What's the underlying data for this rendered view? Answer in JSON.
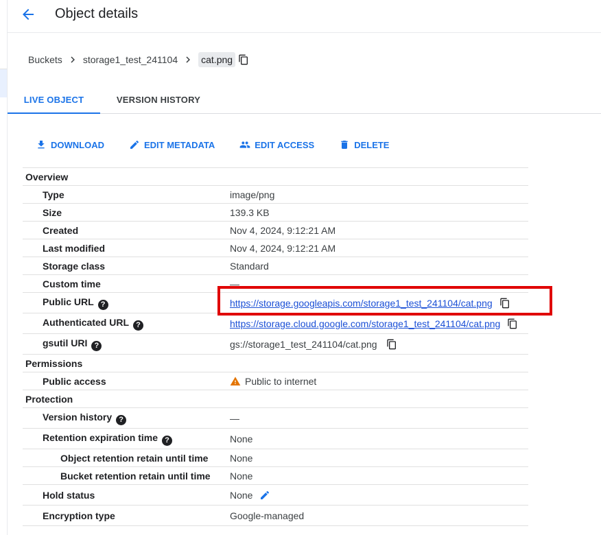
{
  "header": {
    "title": "Object details"
  },
  "breadcrumb": {
    "items": [
      "Buckets",
      "storage1_test_241104"
    ],
    "current": "cat.png"
  },
  "tabs": [
    {
      "label": "LIVE OBJECT",
      "active": true
    },
    {
      "label": "VERSION HISTORY",
      "active": false
    }
  ],
  "actions": {
    "download": "DOWNLOAD",
    "edit_metadata": "EDIT METADATA",
    "edit_access": "EDIT ACCESS",
    "delete": "DELETE"
  },
  "overview": {
    "section": "Overview",
    "type": {
      "label": "Type",
      "value": "image/png"
    },
    "size": {
      "label": "Size",
      "value": "139.3 KB"
    },
    "created": {
      "label": "Created",
      "value": "Nov 4, 2024, 9:12:21 AM"
    },
    "last_modified": {
      "label": "Last modified",
      "value": "Nov 4, 2024, 9:12:21 AM"
    },
    "storage_class": {
      "label": "Storage class",
      "value": "Standard"
    },
    "custom_time": {
      "label": "Custom time",
      "value": "—"
    },
    "public_url": {
      "label": "Public URL",
      "value": "https://storage.googleapis.com/storage1_test_241104/cat.png"
    },
    "authenticated_url": {
      "label": "Authenticated URL",
      "value": "https://storage.cloud.google.com/storage1_test_241104/cat.png"
    },
    "gsutil_uri": {
      "label": "gsutil URI",
      "value": "gs://storage1_test_241104/cat.png"
    }
  },
  "permissions": {
    "section": "Permissions",
    "public_access": {
      "label": "Public access",
      "value": "Public to internet"
    }
  },
  "protection": {
    "section": "Protection",
    "version_history": {
      "label": "Version history",
      "value": "—"
    },
    "retention_expiration": {
      "label": "Retention expiration time",
      "value": "None"
    },
    "object_retention": {
      "label": "Object retention retain until time",
      "value": "None"
    },
    "bucket_retention": {
      "label": "Bucket retention retain until time",
      "value": "None"
    },
    "hold_status": {
      "label": "Hold status",
      "value": "None"
    },
    "encryption_type": {
      "label": "Encryption type",
      "value": "Google-managed"
    }
  },
  "icons": {
    "back": "arrow-back-icon",
    "copy": "copy-icon",
    "download": "download-icon",
    "edit": "pencil-icon",
    "people": "people-icon",
    "delete": "trash-icon",
    "help": "help-icon",
    "warning": "warning-icon"
  },
  "colors": {
    "accent": "#1a73e8",
    "warning": "#e37400",
    "highlight": "#e00000"
  }
}
